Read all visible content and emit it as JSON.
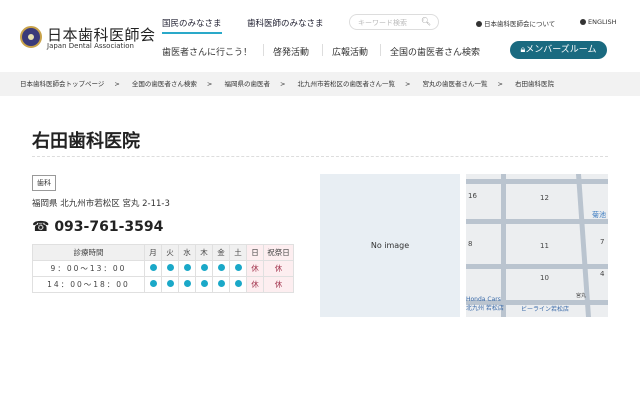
{
  "header": {
    "logo_jp": "日本歯科医師会",
    "logo_en": "Japan Dental Association",
    "nav_top": [
      {
        "label": "国民のみなさま",
        "active": true
      },
      {
        "label": "歯科医師のみなさま",
        "active": false
      }
    ],
    "search_placeholder": "キーワード検索",
    "util_links": [
      "日本歯科医師会について",
      "ENGLISH"
    ],
    "nav_main": [
      "歯医者さんに行こう！",
      "啓発活動",
      "広報活動",
      "全国の歯医者さん検索"
    ],
    "member_button": "メンバーズルーム",
    "accent": "#1a6a80"
  },
  "breadcrumb": [
    "日本歯科医師会トップページ",
    "全国の歯医者さん検索",
    "福岡県の歯医者",
    "北九州市若松区の歯医者さん一覧",
    "宮丸の歯医者さん一覧",
    "右田歯科医院"
  ],
  "breadcrumb_sep": ">",
  "clinic": {
    "name": "右田歯科医院",
    "category": "歯科",
    "address": "福岡県 北九州市若松区 宮丸 2-11-3",
    "phone": "093-761-3594",
    "schedule": {
      "header": [
        "診療時間",
        "月",
        "火",
        "水",
        "木",
        "金",
        "土",
        "日",
        "祝祭日"
      ],
      "rows": [
        {
          "time": "9：00～13：00",
          "days": [
            "open",
            "open",
            "open",
            "open",
            "open",
            "open",
            "休",
            "休"
          ]
        },
        {
          "time": "14：00～18：00",
          "days": [
            "open",
            "open",
            "open",
            "open",
            "open",
            "open",
            "休",
            "休"
          ]
        }
      ]
    }
  },
  "no_image": "No image",
  "map": {
    "labels": [
      "16",
      "12",
      "8",
      "11",
      "7",
      "10",
      "4",
      "菊池",
      "Honda Cars",
      "北九州 若松店",
      "ビーライン若松店",
      "宮丸"
    ]
  }
}
